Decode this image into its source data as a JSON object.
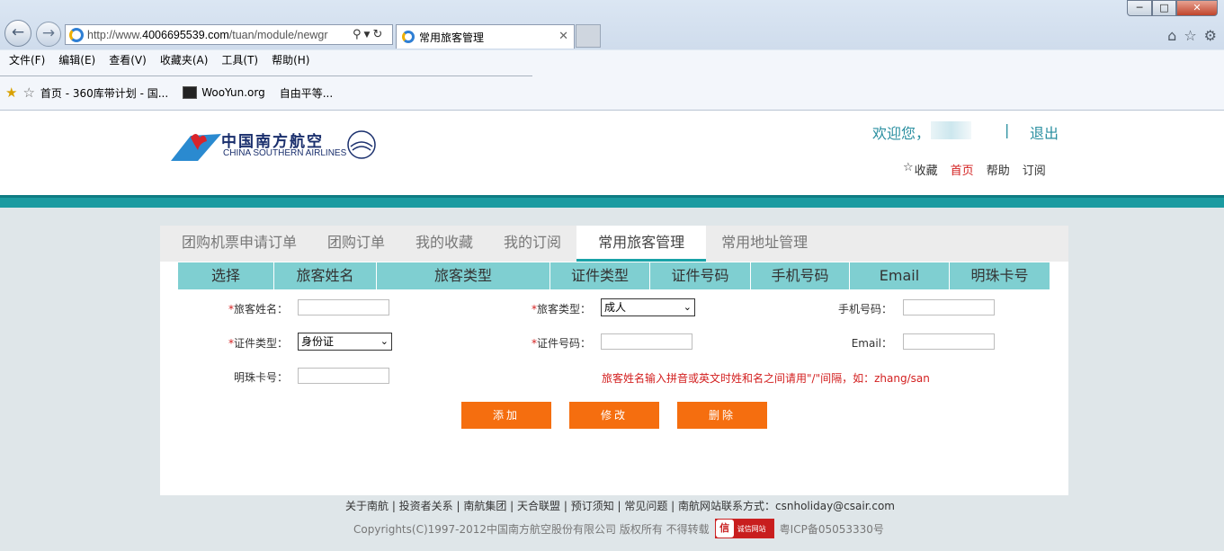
{
  "browser": {
    "address": {
      "prefix": "http://www.",
      "domain": "4006695539.com",
      "path": "/tuan/module/newgr"
    },
    "tab_title": "常用旅客管理",
    "menu": [
      "文件(F)",
      "编辑(E)",
      "查看(V)",
      "收藏夹(A)",
      "工具(T)",
      "帮助(H)"
    ],
    "favorites": [
      "首页 - 360库带计划 - 国...",
      "WooYun.org",
      "自由平等..."
    ]
  },
  "header": {
    "logo_cn": "中国南方航空",
    "logo_en": "CHINA SOUTHERN AIRLINES",
    "welcome": "欢迎您，",
    "separator": "|",
    "logout": "退出",
    "links": {
      "favorite": "收藏",
      "home": "首页",
      "help": "帮助",
      "subscribe": "订阅"
    }
  },
  "tabs": [
    "团购机票申请订单",
    "团购订单",
    "我的收藏",
    "我的订阅",
    "常用旅客管理",
    "常用地址管理"
  ],
  "active_tab": "常用旅客管理",
  "grid_headers": [
    "选择",
    "旅客姓名",
    "旅客类型",
    "证件类型",
    "证件号码",
    "手机号码",
    "Email",
    "明珠卡号"
  ],
  "form": {
    "required_mark": "*",
    "name_label": "旅客姓名：",
    "type_label": "旅客类型：",
    "type_value": "成人",
    "phone_label": "手机号码：",
    "idtype_label": "证件类型：",
    "idtype_value": "身份证",
    "idno_label": "证件号码：",
    "email_label": "Email：",
    "card_label": "明珠卡号：",
    "hint": "旅客姓名输入拼音或英文时姓和名之间请用\"/\"间隔，如：zhang/san"
  },
  "buttons": {
    "add": "添加",
    "edit": "修改",
    "delete": "删除"
  },
  "footer": {
    "links": "关于南航 | 投资者关系 | 南航集团 | 天合联盟 | 预订须知 | 常见问题 | 南航网站联系方式：csnholiday@csair.com",
    "copyright": "Copyrights(C)1997-2012中国南方航空股份有限公司 版权所有 不得转载",
    "badge": "诚信网站",
    "icp": "粤ICP备05053330号"
  }
}
